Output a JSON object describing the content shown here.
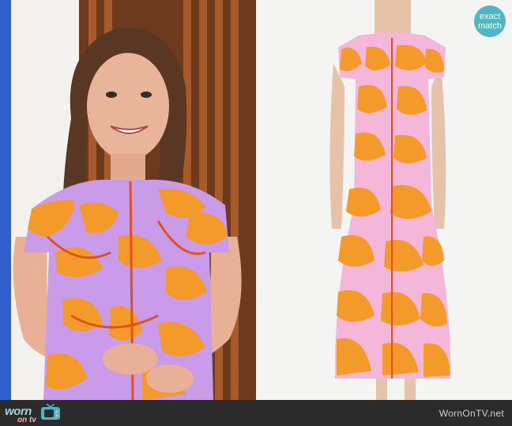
{
  "left_image": {
    "subject": "presenter wearing orange and lilac floral dress"
  },
  "right_image": {
    "subject": "orange and pink floral midi dress product shot"
  },
  "badge": {
    "line1": "exact",
    "line2": "match"
  },
  "brand": {
    "part1": "worn",
    "part2": "on tv"
  },
  "credit": "WornOnTV.net",
  "colors": {
    "orange": "#f39a2a",
    "lilac": "#c99be8",
    "pink": "#f4b6d9",
    "bar": "#2b2b2b",
    "badge": "#4fb7c1"
  }
}
